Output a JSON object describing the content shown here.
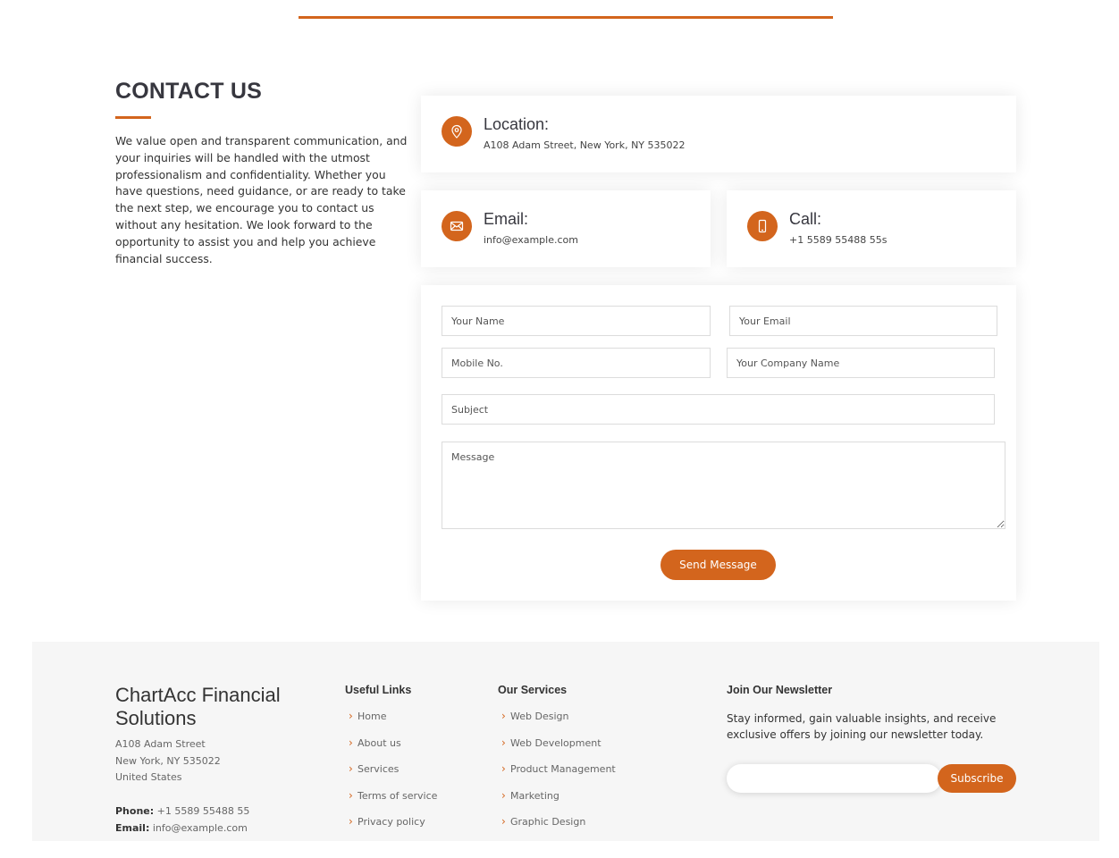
{
  "colors": {
    "accent": "#d3651d",
    "footer_bg": "#f6f6f6"
  },
  "contact": {
    "title": "CONTACT US",
    "intro": "We value open and transparent communication, and your inquiries will be handled with the utmost professionalism and confidentiality. Whether you have questions, need guidance, or are ready to take the next step, we encourage you to contact us without any hesitation. We look forward to the opportunity to assist you and help you achieve financial success."
  },
  "cards": {
    "location": {
      "icon": "map-pin-icon",
      "title": "Location:",
      "value": "A108 Adam Street, New York, NY 535022"
    },
    "email": {
      "icon": "envelope-icon",
      "title": "Email:",
      "value": "info@example.com"
    },
    "call": {
      "icon": "phone-icon",
      "title": "Call:",
      "value": "+1 5589 55488 55s"
    }
  },
  "form": {
    "name_placeholder": "Your Name",
    "email_placeholder": "Your Email",
    "mobile_placeholder": "Mobile No.",
    "company_placeholder": "Your Company Name",
    "subject_placeholder": "Subject",
    "message_placeholder": "Message",
    "submit_label": "Send Message"
  },
  "footer": {
    "brand": "ChartAcc Financial Solutions",
    "address": [
      "A108 Adam Street",
      "New York, NY 535022",
      "United States"
    ],
    "phone_label": "Phone:",
    "phone": "+1 5589 55488 55",
    "email_label": "Email:",
    "email": "info@example.com",
    "useful_links": {
      "title": "Useful Links",
      "items": [
        "Home",
        "About us",
        "Services",
        "Terms of service",
        "Privacy policy"
      ]
    },
    "services": {
      "title": "Our Services",
      "items": [
        "Web Design",
        "Web Development",
        "Product Management",
        "Marketing",
        "Graphic Design"
      ]
    },
    "newsletter": {
      "title": "Join Our Newsletter",
      "text": "Stay informed, gain valuable insights, and receive exclusive offers by joining our newsletter today.",
      "input_value": "",
      "button_label": "Subscribe"
    }
  }
}
